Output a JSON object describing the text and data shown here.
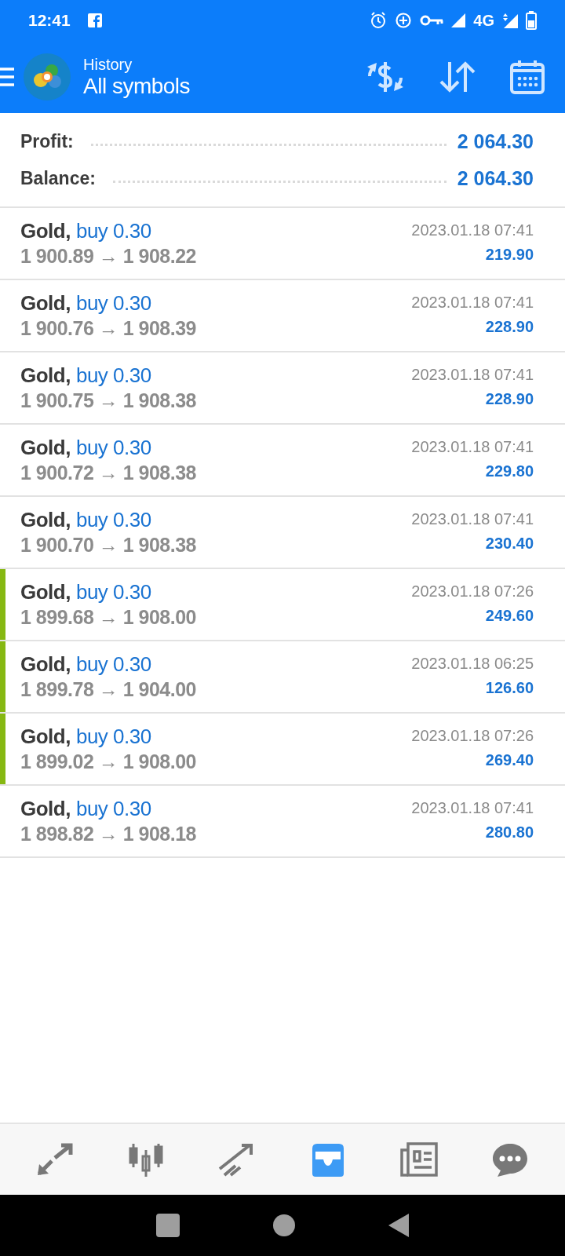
{
  "status_bar": {
    "time": "12:41",
    "network": "4G"
  },
  "header": {
    "subtitle": "History",
    "title": "All symbols"
  },
  "summary": [
    {
      "label": "Profit:",
      "value": "2 064.30"
    },
    {
      "label": "Balance:",
      "value": "2 064.30"
    }
  ],
  "deals": [
    {
      "symbol": "Gold,",
      "side": "buy 0.30",
      "prices": "1 900.89 → 1 908.22",
      "time": "2023.01.18 07:41",
      "profit": "219.90",
      "flagged": false
    },
    {
      "symbol": "Gold,",
      "side": "buy 0.30",
      "prices": "1 900.76 → 1 908.39",
      "time": "2023.01.18 07:41",
      "profit": "228.90",
      "flagged": false
    },
    {
      "symbol": "Gold,",
      "side": "buy 0.30",
      "prices": "1 900.75 → 1 908.38",
      "time": "2023.01.18 07:41",
      "profit": "228.90",
      "flagged": false
    },
    {
      "symbol": "Gold,",
      "side": "buy 0.30",
      "prices": "1 900.72 → 1 908.38",
      "time": "2023.01.18 07:41",
      "profit": "229.80",
      "flagged": false
    },
    {
      "symbol": "Gold,",
      "side": "buy 0.30",
      "prices": "1 900.70 → 1 908.38",
      "time": "2023.01.18 07:41",
      "profit": "230.40",
      "flagged": false
    },
    {
      "symbol": "Gold,",
      "side": "buy 0.30",
      "prices": "1 899.68 → 1 908.00",
      "time": "2023.01.18 07:26",
      "profit": "249.60",
      "flagged": true
    },
    {
      "symbol": "Gold,",
      "side": "buy 0.30",
      "prices": "1 899.78 → 1 904.00",
      "time": "2023.01.18 06:25",
      "profit": "126.60",
      "flagged": true
    },
    {
      "symbol": "Gold,",
      "side": "buy 0.30",
      "prices": "1 899.02 → 1 908.00",
      "time": "2023.01.18 07:26",
      "profit": "269.40",
      "flagged": true
    },
    {
      "symbol": "Gold,",
      "side": "buy 0.30",
      "prices": "1 898.82 → 1 908.18",
      "time": "2023.01.18 07:41",
      "profit": "280.80",
      "flagged": false
    }
  ],
  "tabs": [
    {
      "kind": "trade",
      "selected": false
    },
    {
      "kind": "quotes",
      "selected": false
    },
    {
      "kind": "chart",
      "selected": false
    },
    {
      "kind": "history",
      "selected": true
    },
    {
      "kind": "news",
      "selected": false
    },
    {
      "kind": "chat",
      "selected": false
    }
  ]
}
